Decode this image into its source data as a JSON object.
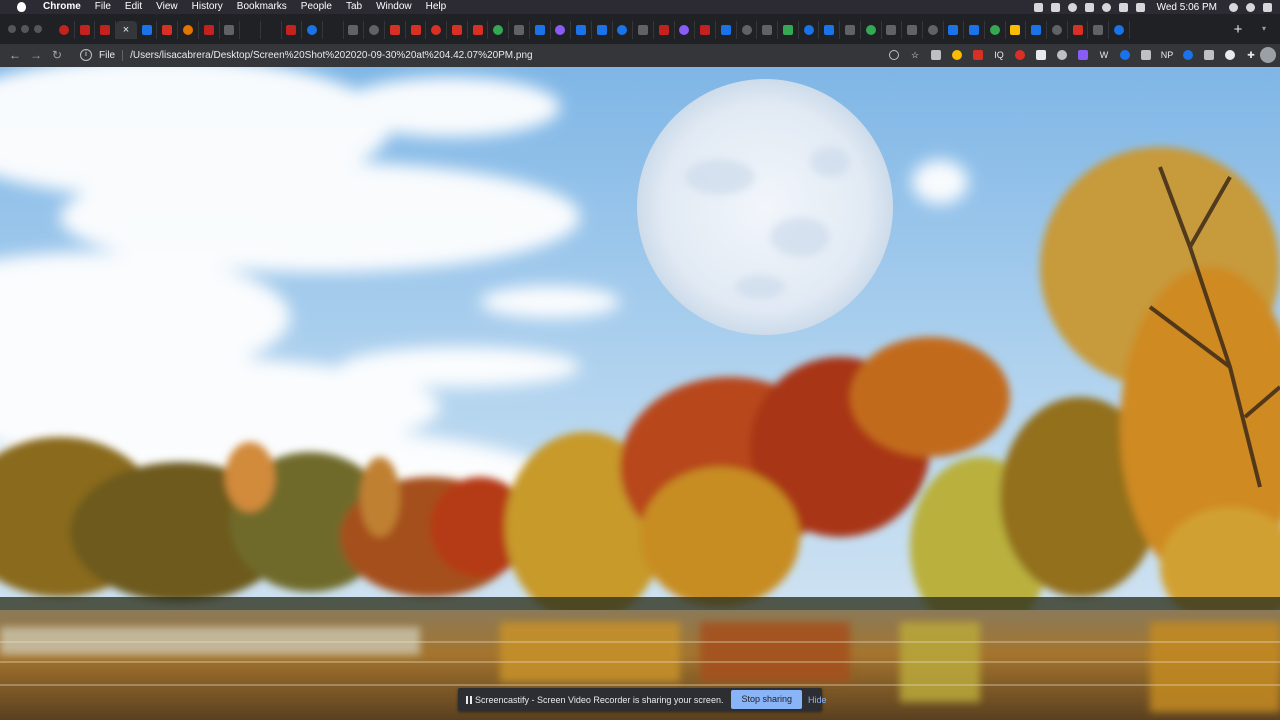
{
  "menubar": {
    "app": "Chrome",
    "items": [
      "File",
      "Edit",
      "View",
      "History",
      "Bookmarks",
      "People",
      "Tab",
      "Window",
      "Help"
    ],
    "clock": "Wed 5:06 PM"
  },
  "tabs": {
    "colors": [
      "#c5221f",
      "#c5221f",
      "#c5221f",
      "#34a853",
      "#1a73e8",
      "#d93025",
      "#e37400",
      "#c5221f",
      "#5f6368",
      "#202124",
      "#202124",
      "#c5221f",
      "#1a73e8",
      "#202124",
      "#5f6368",
      "#5f6368",
      "#d93025",
      "#d93025",
      "#d93025",
      "#d93025",
      "#d93025",
      "#34a853",
      "#5f6368",
      "#1a73e8",
      "#8a5cf6",
      "#1a73e8",
      "#1a73e8",
      "#1a73e8",
      "#5f6368",
      "#c5221f",
      "#8a5cf6",
      "#c5221f",
      "#1a73e8",
      "#5f6368",
      "#5f6368",
      "#34a853",
      "#1a73e8",
      "#1a73e8",
      "#5f6368",
      "#34a853",
      "#5f6368",
      "#5f6368",
      "#5f6368",
      "#1a73e8",
      "#1a73e8",
      "#34a853",
      "#fbbc04",
      "#1a73e8",
      "#5f6368",
      "#d93025",
      "#5f6368",
      "#1a73e8"
    ],
    "active_index": 3,
    "new_tab_label": "+",
    "tab_search": "▾"
  },
  "toolbar": {
    "scheme": "File",
    "url": "/Users/lisacabrera/Desktop/Screen%20Shot%202020-09-30%20at%204.42.07%20PM.png",
    "extension_colors": [
      "#bdc1c6",
      "#fbbc04",
      "#d93025",
      "#d93025",
      "#e8eaed",
      "#bdc1c6",
      "#8a5cf6",
      "#1a73e8",
      "#bdc1c6",
      "#1a73e8",
      "#bdc1c6",
      "#e8eaed"
    ],
    "extension_texts": [
      "IQ",
      "W",
      "NP"
    ]
  },
  "sharebar": {
    "message": "Screencastify - Screen Video Recorder is sharing your screen.",
    "stop_label": "Stop sharing",
    "hide_label": "Hide"
  }
}
